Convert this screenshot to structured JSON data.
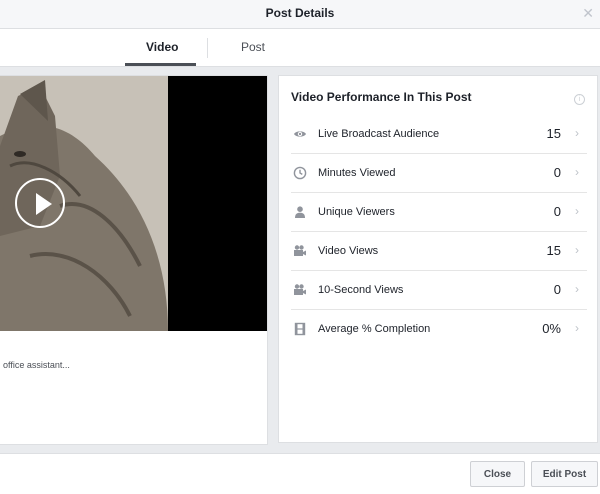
{
  "dialog": {
    "title": "Post Details"
  },
  "tabs": [
    {
      "label": "Video"
    },
    {
      "label": "Post"
    }
  ],
  "post": {
    "caption": "office assistant..."
  },
  "performance": {
    "title": "Video Performance In This Post",
    "metrics": [
      {
        "icon": "eye-icon",
        "label": "Live Broadcast Audience",
        "value": "15"
      },
      {
        "icon": "clock-icon",
        "label": "Minutes Viewed",
        "value": "0"
      },
      {
        "icon": "person-icon",
        "label": "Unique Viewers",
        "value": "0"
      },
      {
        "icon": "video-camera-icon",
        "label": "Video Views",
        "value": "15"
      },
      {
        "icon": "video-camera-icon",
        "label": "10-Second Views",
        "value": "0"
      },
      {
        "icon": "film-icon",
        "label": "Average % Completion",
        "value": "0%"
      }
    ]
  },
  "footer": {
    "close_label": "Close",
    "edit_label": "Edit Post"
  }
}
